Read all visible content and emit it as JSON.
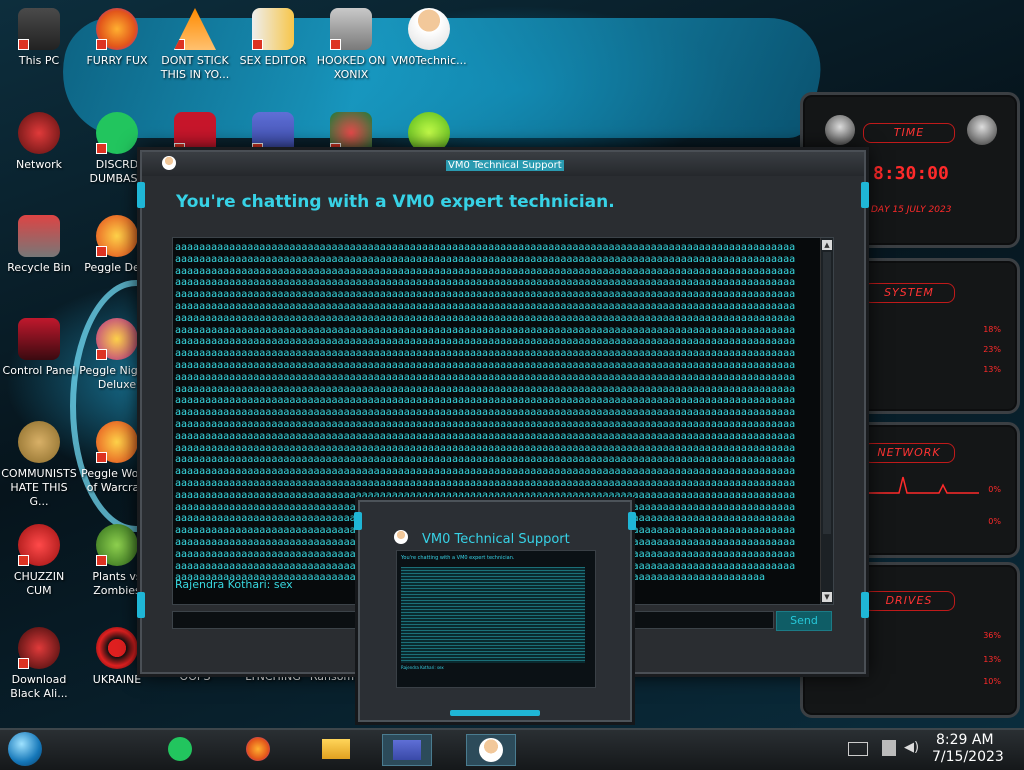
{
  "desktop": {
    "icons": [
      {
        "label": "This PC"
      },
      {
        "label": "FURRY FUX"
      },
      {
        "label": "DONT STICK THIS IN YO..."
      },
      {
        "label": "SEX EDITOR"
      },
      {
        "label": "HOOKED ON XONIX"
      },
      {
        "label": "VM0Technic..."
      },
      {
        "label": "Network"
      },
      {
        "label": "DISCRD DUMBASS"
      },
      {
        "label": "Recycle Bin"
      },
      {
        "label": "Peggle Delu"
      },
      {
        "label": "Control Panel"
      },
      {
        "label": "Peggle Nights Deluxe"
      },
      {
        "label": "COMMUNISTS HATE THIS G..."
      },
      {
        "label": "Peggle World of Warcraft"
      },
      {
        "label": "CHUZZIN CUM"
      },
      {
        "label": "Plants vs Zombies"
      },
      {
        "label": "Download Black Ali..."
      },
      {
        "label": "UKRAINE"
      },
      {
        "label": "OOPS"
      },
      {
        "label": "LYNCHING"
      },
      {
        "label": "Ransom"
      }
    ]
  },
  "chat_window": {
    "title": "VM0 Technical Support",
    "headline": "You're chatting with a VM0 expert technician.",
    "log_line": "aaaaaaaaaaaaaaaaaaaaaaaaaaaaaaaaaaaaaaaaaaaaaaaaaaaaaaaaaaaaaaaaaaaaaaaaaaaaaaaaaaaaaaaaaaaaaaaaaaaaaaa",
    "log_line_count": 28,
    "last_partial_line": "aaaaaaaaaaaaaaaaaaaaaaaaaaaaaaaaaaaaaaaaaaaaaaaaaaaaaaaaaaaaaaaaaaaaaaaaaaaaaaaaaaaaaaaaaaaaaaaaaa",
    "message": "Rajendra Kothari: sex",
    "input_value": "",
    "send_label": "Send"
  },
  "mini_window": {
    "title": "VM0 Technical Support",
    "headline": "You're chatting with a VM0 expert technician.",
    "message": "Rajendra Kothari: sex"
  },
  "widgets": {
    "time": {
      "title": "TIME",
      "clock": "8:30:00",
      "date": "DAY 15 JULY 2023"
    },
    "system": {
      "title": "SYSTEM",
      "values": [
        "18%",
        "23%",
        "13%"
      ]
    },
    "network": {
      "title": "NETWORK",
      "values": [
        "0%",
        "0%"
      ]
    },
    "drives": {
      "title": "DRIVES",
      "values": [
        "36%",
        "13%",
        "10%"
      ]
    }
  },
  "taskbar": {
    "time": "8:29 AM",
    "date": "7/15/2023"
  },
  "colors": {
    "accent": "#37d2e6",
    "widget_red": "#ff2a2a",
    "send_bg": "#0f5d66"
  }
}
